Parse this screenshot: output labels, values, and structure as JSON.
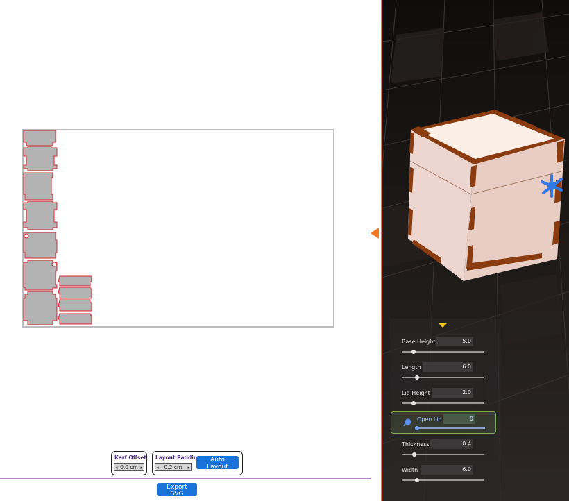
{
  "layout_controls": {
    "kerf_offset": {
      "label": "Kerf Offset",
      "value": "0.0 cm"
    },
    "layout_padding": {
      "label": "Layout Padding",
      "value": "0.2 cm"
    },
    "auto_layout_label": "Auto Layout",
    "export_svg_label": "Export SVG"
  },
  "parameters": [
    {
      "label": "Base Height",
      "value": "5.0",
      "level": 0.14
    },
    {
      "label": "Length",
      "value": "6.0",
      "level": 0.19
    },
    {
      "label": "Lid Height",
      "value": "2.0",
      "level": 0.14
    },
    {
      "label": "Open Lid",
      "value": "0",
      "level": 0.0
    },
    {
      "label": "Thickness",
      "value": "0.4",
      "level": 0.15
    },
    {
      "label": "Width",
      "value": "6.0",
      "level": 0.19
    }
  ],
  "colors": {
    "accent": "#f2791f",
    "piece_fill": "#b3b3b3",
    "piece_outline": "#d9232e",
    "button_blue": "#1a73d9",
    "open_lid_border": "#7dab57",
    "wood_face": "#ecd6cf",
    "wood_edge": "#8a3b10",
    "gizmo_blue": "#2f78e6"
  },
  "icons": {
    "splitter": "double-triangle-arrows-icon",
    "collapse": "chevron-down-triangle-icon",
    "open_lid": "paint-drop-icon",
    "gizmo": "transform-gizmo-icon"
  }
}
